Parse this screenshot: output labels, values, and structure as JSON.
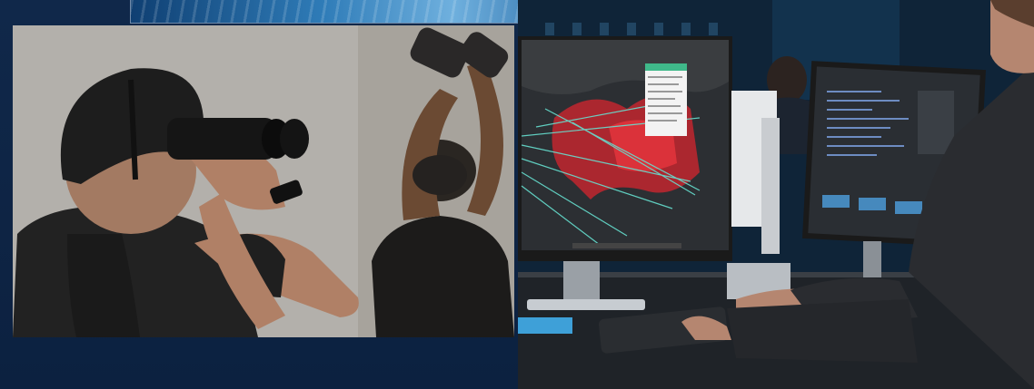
{
  "image": {
    "description_hidden": true
  },
  "icons": {
    "binoculars": "binoculars-icon",
    "monitor": "monitor-icon",
    "keyboard": "keyboard-icon"
  },
  "colors": {
    "background": "#0e2440",
    "map_overlay": "#e0343c",
    "route_lines": "#66e0d0"
  }
}
